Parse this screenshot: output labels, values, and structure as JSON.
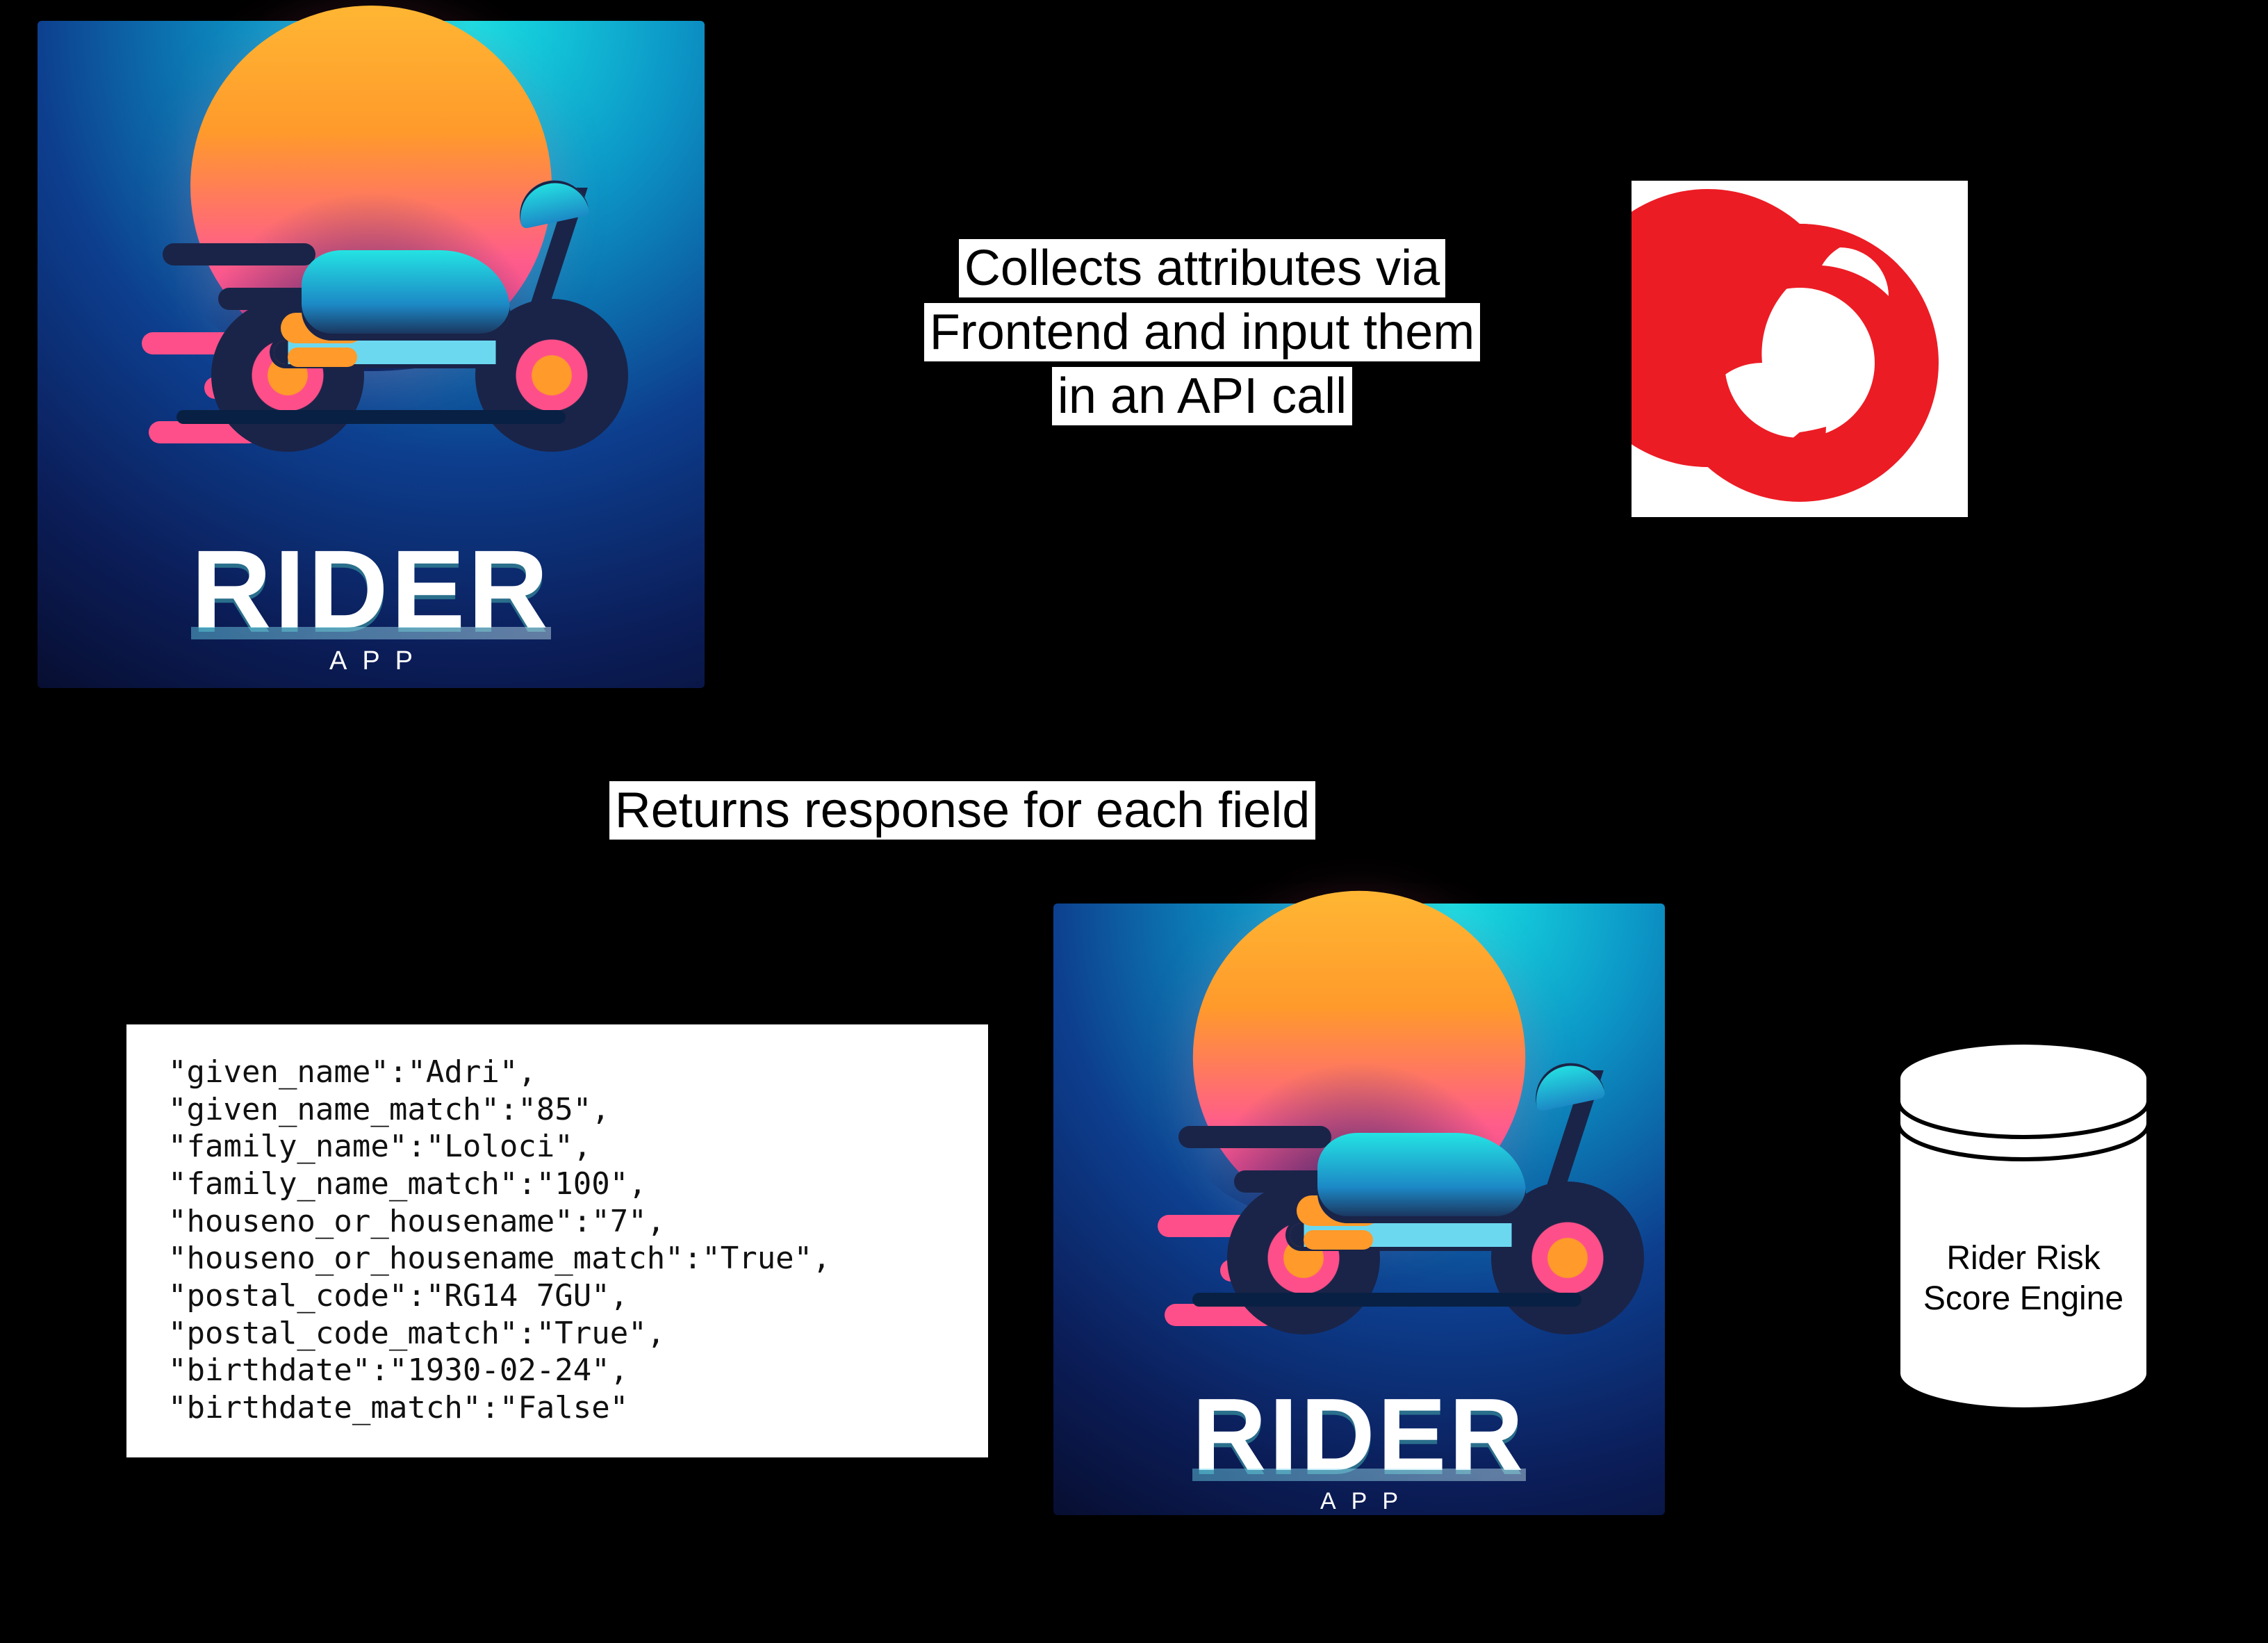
{
  "logos": {
    "rider_title": "RIDER",
    "rider_subtitle": "APP",
    "vodafone": "vodafone-logo"
  },
  "labels": {
    "collect_l1": "Collects attributes via",
    "collect_l2": "Frontend and input them",
    "collect_l3": "in an API call",
    "returns": "Returns response for each field"
  },
  "response_fields": [
    {
      "key": "given_name",
      "value": "Adri"
    },
    {
      "key": "given_name_match",
      "value": "85"
    },
    {
      "key": "family_name",
      "value": "Loloci"
    },
    {
      "key": "family_name_match",
      "value": "100"
    },
    {
      "key": "houseno_or_housename",
      "value": "7"
    },
    {
      "key": "houseno_or_housename_match",
      "value": "True"
    },
    {
      "key": "postal_code",
      "value": "RG14 7GU"
    },
    {
      "key": "postal_code_match",
      "value": "True"
    },
    {
      "key": "birthdate",
      "value": "1930-02-24"
    },
    {
      "key": "birthdate_match",
      "value": "False"
    }
  ],
  "database": {
    "line1": "Rider Risk",
    "line2": "Score Engine"
  },
  "colors": {
    "vodafone_red": "#ec1c24"
  }
}
